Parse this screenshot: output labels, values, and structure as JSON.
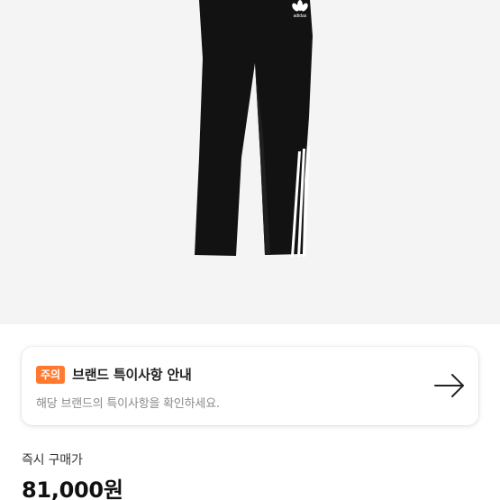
{
  "product": {
    "image_icon": "track-pants-photo",
    "logo_icon": "trefoil-logo",
    "logo_text": "adidas"
  },
  "notice": {
    "badge": "주의",
    "title": "브랜드 특이사항 안내",
    "description": "해당 브랜드의 특이사항을 확인하세요.",
    "arrow_icon": "arrow-right-icon",
    "badge_color": "#ffffff",
    "badge_bg": "#ff7a2f"
  },
  "price": {
    "label": "즉시 구매가",
    "value": "81,000원"
  }
}
